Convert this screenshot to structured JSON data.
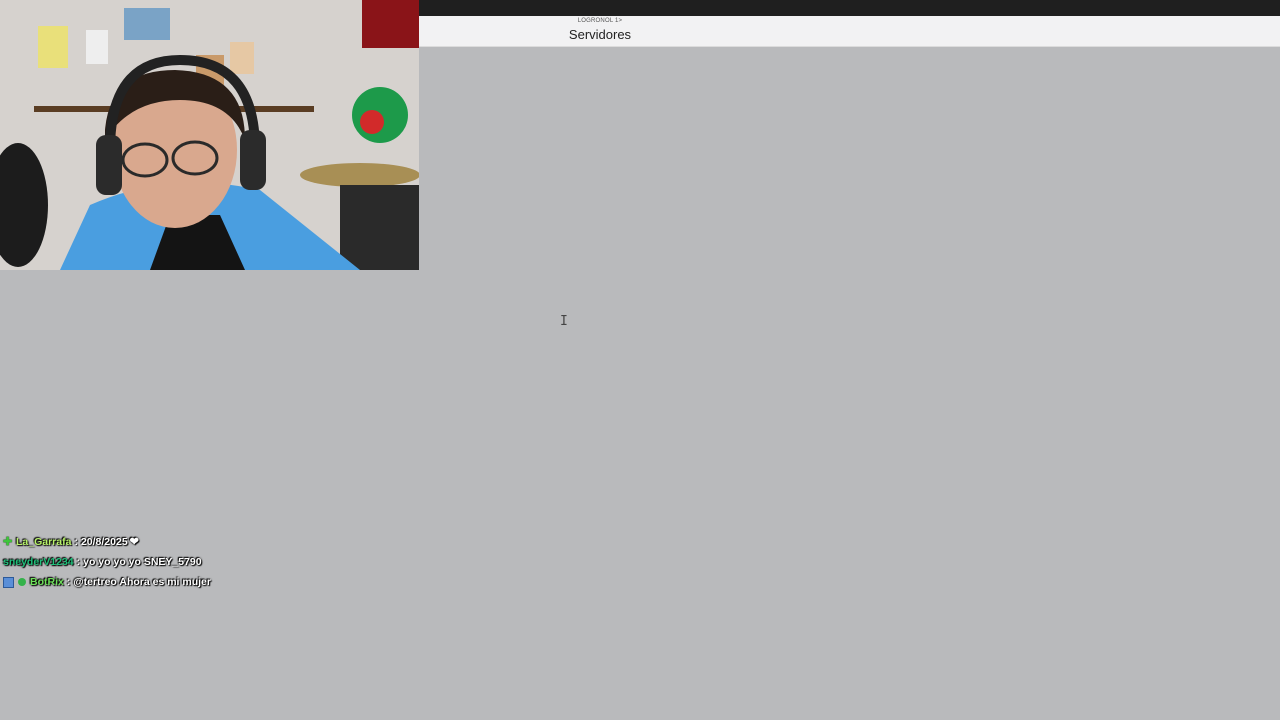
{
  "header": {
    "subtitle": "LOGRONOL 1>",
    "title": "Servidores"
  },
  "cursor": {
    "glyph": "I",
    "icon": "text-cursor-icon"
  },
  "chat": {
    "messages": [
      {
        "user": "La_Garrafa",
        "user_color": "#b7f26a",
        "separator": ":",
        "text": "20/8/2025",
        "badges": [
          "plus-badge-icon"
        ],
        "trailing_icon": "heart-emote-icon"
      },
      {
        "user": "sneyderV1234",
        "user_color": "#1fbf7a",
        "separator": ":",
        "text": "yo yo yo yo SNEY_5790",
        "badges": []
      },
      {
        "user": "BotRix",
        "user_color": "#6ee05a",
        "separator": ":",
        "text": "@tertreo Ahora es mi mujer",
        "badges": [
          "bot-badge-icon",
          "verified-badge-icon"
        ]
      }
    ]
  },
  "colors": {
    "background": "#b9babc",
    "topbar": "#1f1f1f",
    "header": "#f2f2f3"
  }
}
